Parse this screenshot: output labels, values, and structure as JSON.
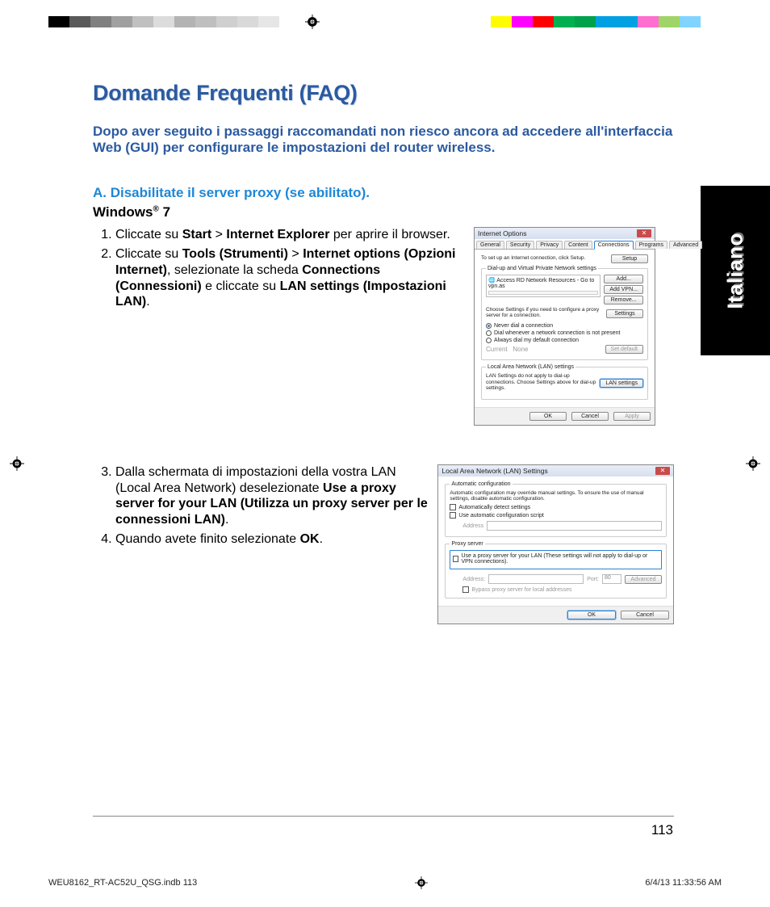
{
  "regmark_colors_left": [
    "#000000",
    "#595959",
    "#808080",
    "#a0a0a0",
    "#c0c0c0",
    "#dcdcdc",
    "#b3b3b3",
    "#bfbfbf",
    "#cfcfcf",
    "#d9d9d9",
    "#e6e6e6",
    "#ffffff"
  ],
  "regmark_colors_right": [
    "#ffffff",
    "#fffb00",
    "#ff00ff",
    "#ff0000",
    "#00b050",
    "#00a14b",
    "#00a0e3",
    "#00a0e3",
    "#ff6fcf",
    "#a0d468",
    "#80d4ff",
    "#ffffff"
  ],
  "heading": "Domande Frequenti (FAQ)",
  "intro": "Dopo aver seguito i passaggi raccomandati non riesco ancora ad accedere all'interfaccia Web (GUI) per configurare le impostazioni del router wireless.",
  "sectionA": "A. Disabilitate il server proxy (se abilitato).",
  "os": "Windows",
  "os_suffix": "7",
  "steps1": [
    {
      "pre": "Cliccate su ",
      "b1": "Start",
      "mid1": " > ",
      "b2": "Internet Explorer",
      "post": " per aprire il browser."
    },
    {
      "pre": "Cliccate su ",
      "b1": "Tools (Strumenti)",
      "mid1": " > ",
      "b2": "Internet options (Opzioni Internet)",
      "mid2": ", selezionate la scheda ",
      "b3": "Connections (Connessioni)",
      "mid3": " e cliccate su ",
      "b4": "LAN settings (Impostazioni LAN)",
      "post": "."
    }
  ],
  "steps2": [
    {
      "pre": "Dalla schermata di impostazioni della vostra LAN (Local Area Network) deselezionate ",
      "b1": "Use a proxy server for your LAN (Utilizza un proxy server per le connessioni LAN)",
      "post": "."
    },
    {
      "pre": "Quando avete finito selezionate ",
      "b1": "OK",
      "post": "."
    }
  ],
  "lang_tab": "Italiano",
  "dlg1": {
    "title": "Internet Options",
    "tabs": [
      "General",
      "Security",
      "Privacy",
      "Content",
      "Connections",
      "Programs",
      "Advanced"
    ],
    "active_tab": "Connections",
    "setup_text": "To set up an Internet connection, click Setup.",
    "setup_btn": "Setup",
    "dial_legend": "Dial-up and Virtual Private Network settings",
    "list_item": "Access RD Network Resources - Go to vpn.as",
    "btn_add": "Add...",
    "btn_addvpn": "Add VPN...",
    "btn_remove": "Remove...",
    "choose_text": "Choose Settings if you need to configure a proxy server for a connection.",
    "btn_settings": "Settings",
    "r_never": "Never dial a connection",
    "r_dial": "Dial whenever a network connection is not present",
    "r_always": "Always dial my default connection",
    "current": "Current",
    "none": "None",
    "setdef": "Set default",
    "lan_legend": "Local Area Network (LAN) settings",
    "lan_text": "LAN Settings do not apply to dial-up connections. Choose Settings above for dial-up settings.",
    "btn_lan": "LAN settings",
    "ok": "OK",
    "cancel": "Cancel",
    "apply": "Apply"
  },
  "dlg2": {
    "title": "Local Area Network (LAN) Settings",
    "auto_legend": "Automatic configuration",
    "auto_text": "Automatic configuration may override manual settings. To ensure the use of manual settings, disable automatic configuration.",
    "c_autodetect": "Automatically detect settings",
    "c_script": "Use automatic configuration script",
    "addr_label": "Address",
    "proxy_legend": "Proxy server",
    "proxy_check": "Use a proxy server for your LAN (These settings will not apply to dial-up or VPN connections).",
    "addr": "Address:",
    "port": "Port:",
    "port_val": "80",
    "adv": "Advanced",
    "bypass": "Bypass proxy server for local addresses",
    "ok": "OK",
    "cancel": "Cancel"
  },
  "page_number": "113",
  "footer_file": "WEU8162_RT-AC52U_QSG.indb   113",
  "footer_date": "6/4/13   11:33:56 AM"
}
